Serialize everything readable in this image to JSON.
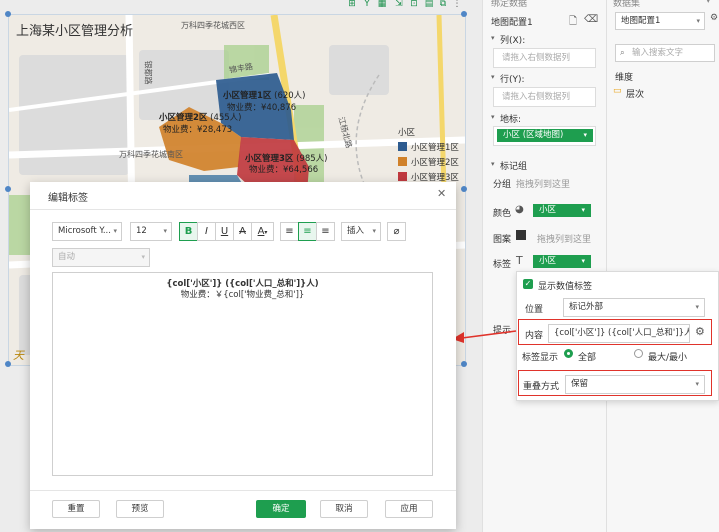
{
  "map": {
    "title": "上海某小区管理分析",
    "labels": {
      "road1": "万科四季花城西区",
      "road2": "万科四季花城南区",
      "road3": "锦丰路",
      "road4": "江杨北路",
      "road5": "银都路"
    },
    "regions": [
      {
        "name": "小区管理1区",
        "people": "(620人)",
        "fee": "物业费：¥40,876",
        "color": "#2d5b8f"
      },
      {
        "name": "小区管理2区",
        "people": "(455人)",
        "fee": "物业费：¥28,473",
        "color": "#d0812a"
      },
      {
        "name": "小区管理3区",
        "people": "(985人)",
        "fee": "物业费：¥64,566",
        "color": "#c0393f"
      }
    ],
    "watermark": "天"
  },
  "legend": {
    "title": "小区",
    "items": [
      {
        "label": "小区管理1区",
        "color": "#2d5b8f"
      },
      {
        "label": "小区管理2区",
        "color": "#d0812a"
      },
      {
        "label": "小区管理3区",
        "color": "#c0393f"
      }
    ]
  },
  "panel": {
    "header_cut": "绑定数据",
    "config_name": "地图配置1",
    "col_label": "列(X):",
    "col_placeholder": "请拖入右侧数据列",
    "row_label": "行(Y):",
    "row_placeholder": "请拖入右侧数据列",
    "geo_label": "地标:",
    "geo_value": "小区 (区域地图)",
    "marks_label": "标记组",
    "group_label": "分组",
    "group_placeholder": "拖拽列到这里",
    "color_label": "颜色",
    "color_value": "小区",
    "pattern_label": "图案",
    "pattern_placeholder": "拖拽列到这里",
    "tag_label": "标签",
    "tag_value": "小区",
    "tips_label": "提示"
  },
  "panel2": {
    "header_cut": "数据集",
    "dataset": "地图配置1",
    "search_placeholder": "输入搜索文字",
    "dim_label": "维度",
    "folder_label": "层次"
  },
  "popover": {
    "show_values": "显示数值标签",
    "position_label": "位置",
    "position_value": "标记外部",
    "content_label": "内容",
    "content_value": "{col['小区']} ({col['人口_总和']}人) ...",
    "display_label": "标签显示",
    "display_all": "全部",
    "display_minmax": "最大/最小",
    "overlap_label": "重叠方式",
    "overlap_value": "保留"
  },
  "dialog": {
    "title": "编辑标签",
    "font_family": "Microsoft Y...",
    "font_size": "12",
    "bold": "B",
    "italic": "I",
    "underline": "U",
    "strike": "A",
    "color": "A",
    "insert": "插入",
    "auto": "自动",
    "content_line1": "{col['小区']} ({col['人口_总和']}人)",
    "content_line2": "物业费：￥{col['物业费_总和']}",
    "reset": "重置",
    "preview": "预览",
    "ok": "确定",
    "cancel": "取消",
    "apply": "应用"
  },
  "colors": {
    "accent": "#1e9e4f",
    "highlight": "#e0332b"
  }
}
